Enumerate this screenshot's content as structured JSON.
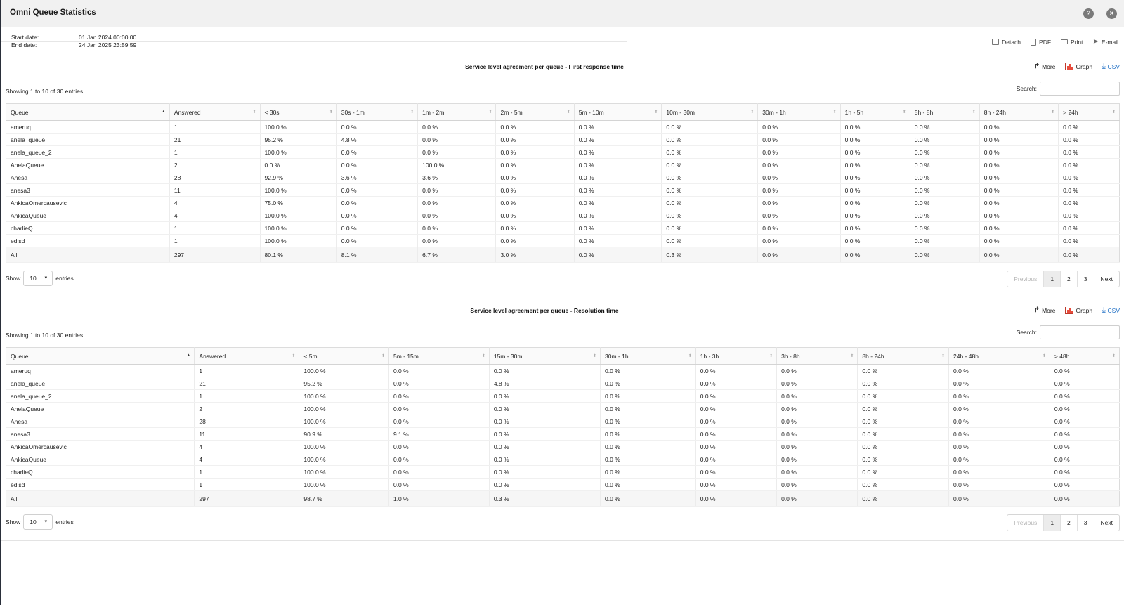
{
  "window": {
    "title": "Omni Queue Statistics",
    "help_icon": "question-circle-icon",
    "close_icon": "close-circle-icon"
  },
  "dates": {
    "start_label": "Start date:",
    "start_value": "01 Jan 2024 00:00:00",
    "end_label": "End date:",
    "end_value": "24 Jan 2025 23:59:59"
  },
  "toolbar": {
    "detach": "Detach",
    "pdf": "PDF",
    "print": "Print",
    "email": "E-mail"
  },
  "actions": {
    "more": "More",
    "graph": "Graph",
    "csv": "CSV"
  },
  "common": {
    "search_label": "Search:",
    "show_label": "Show",
    "entries_label": "entries",
    "page_length": "10",
    "pages": [
      "Previous",
      "1",
      "2",
      "3",
      "Next"
    ],
    "active_page": "1"
  },
  "tables": [
    {
      "title": "Service level agreement per queue - First response time",
      "showing": "Showing 1 to 10 of 30 entries",
      "columns": [
        "Queue",
        "Answered",
        "< 30s",
        "30s - 1m",
        "1m - 2m",
        "2m - 5m",
        "5m - 10m",
        "10m - 30m",
        "30m - 1h",
        "1h - 5h",
        "5h - 8h",
        "8h - 24h",
        "> 24h"
      ],
      "rows": [
        [
          "ameruq",
          "1",
          "100.0 %",
          "0.0 %",
          "0.0 %",
          "0.0 %",
          "0.0 %",
          "0.0 %",
          "0.0 %",
          "0.0 %",
          "0.0 %",
          "0.0 %",
          "0.0 %"
        ],
        [
          "anela_queue",
          "21",
          "95.2 %",
          "4.8 %",
          "0.0 %",
          "0.0 %",
          "0.0 %",
          "0.0 %",
          "0.0 %",
          "0.0 %",
          "0.0 %",
          "0.0 %",
          "0.0 %"
        ],
        [
          "anela_queue_2",
          "1",
          "100.0 %",
          "0.0 %",
          "0.0 %",
          "0.0 %",
          "0.0 %",
          "0.0 %",
          "0.0 %",
          "0.0 %",
          "0.0 %",
          "0.0 %",
          "0.0 %"
        ],
        [
          "AnelaQueue",
          "2",
          "0.0 %",
          "0.0 %",
          "100.0 %",
          "0.0 %",
          "0.0 %",
          "0.0 %",
          "0.0 %",
          "0.0 %",
          "0.0 %",
          "0.0 %",
          "0.0 %"
        ],
        [
          "Anesa",
          "28",
          "92.9 %",
          "3.6 %",
          "3.6 %",
          "0.0 %",
          "0.0 %",
          "0.0 %",
          "0.0 %",
          "0.0 %",
          "0.0 %",
          "0.0 %",
          "0.0 %"
        ],
        [
          "anesa3",
          "11",
          "100.0 %",
          "0.0 %",
          "0.0 %",
          "0.0 %",
          "0.0 %",
          "0.0 %",
          "0.0 %",
          "0.0 %",
          "0.0 %",
          "0.0 %",
          "0.0 %"
        ],
        [
          "AnkicaOmercausevic",
          "4",
          "75.0 %",
          "0.0 %",
          "0.0 %",
          "0.0 %",
          "0.0 %",
          "0.0 %",
          "0.0 %",
          "0.0 %",
          "0.0 %",
          "0.0 %",
          "0.0 %"
        ],
        [
          "AnkicaQueue",
          "4",
          "100.0 %",
          "0.0 %",
          "0.0 %",
          "0.0 %",
          "0.0 %",
          "0.0 %",
          "0.0 %",
          "0.0 %",
          "0.0 %",
          "0.0 %",
          "0.0 %"
        ],
        [
          "charlieQ",
          "1",
          "100.0 %",
          "0.0 %",
          "0.0 %",
          "0.0 %",
          "0.0 %",
          "0.0 %",
          "0.0 %",
          "0.0 %",
          "0.0 %",
          "0.0 %",
          "0.0 %"
        ],
        [
          "edisd",
          "1",
          "100.0 %",
          "0.0 %",
          "0.0 %",
          "0.0 %",
          "0.0 %",
          "0.0 %",
          "0.0 %",
          "0.0 %",
          "0.0 %",
          "0.0 %",
          "0.0 %"
        ]
      ],
      "total": [
        "All",
        "297",
        "80.1 %",
        "8.1 %",
        "6.7 %",
        "3.0 %",
        "0.0 %",
        "0.3 %",
        "0.0 %",
        "0.0 %",
        "0.0 %",
        "0.0 %",
        "0.0 %"
      ]
    },
    {
      "title": "Service level agreement per queue - Resolution time",
      "showing": "Showing 1 to 10 of 30 entries",
      "columns": [
        "Queue",
        "Answered",
        "< 5m",
        "5m - 15m",
        "15m - 30m",
        "30m - 1h",
        "1h - 3h",
        "3h - 8h",
        "8h - 24h",
        "24h - 48h",
        "> 48h"
      ],
      "rows": [
        [
          "ameruq",
          "1",
          "100.0 %",
          "0.0 %",
          "0.0 %",
          "0.0 %",
          "0.0 %",
          "0.0 %",
          "0.0 %",
          "0.0 %",
          "0.0 %"
        ],
        [
          "anela_queue",
          "21",
          "95.2 %",
          "0.0 %",
          "4.8 %",
          "0.0 %",
          "0.0 %",
          "0.0 %",
          "0.0 %",
          "0.0 %",
          "0.0 %"
        ],
        [
          "anela_queue_2",
          "1",
          "100.0 %",
          "0.0 %",
          "0.0 %",
          "0.0 %",
          "0.0 %",
          "0.0 %",
          "0.0 %",
          "0.0 %",
          "0.0 %"
        ],
        [
          "AnelaQueue",
          "2",
          "100.0 %",
          "0.0 %",
          "0.0 %",
          "0.0 %",
          "0.0 %",
          "0.0 %",
          "0.0 %",
          "0.0 %",
          "0.0 %"
        ],
        [
          "Anesa",
          "28",
          "100.0 %",
          "0.0 %",
          "0.0 %",
          "0.0 %",
          "0.0 %",
          "0.0 %",
          "0.0 %",
          "0.0 %",
          "0.0 %"
        ],
        [
          "anesa3",
          "11",
          "90.9 %",
          "9.1 %",
          "0.0 %",
          "0.0 %",
          "0.0 %",
          "0.0 %",
          "0.0 %",
          "0.0 %",
          "0.0 %"
        ],
        [
          "AnkicaOmercausevic",
          "4",
          "100.0 %",
          "0.0 %",
          "0.0 %",
          "0.0 %",
          "0.0 %",
          "0.0 %",
          "0.0 %",
          "0.0 %",
          "0.0 %"
        ],
        [
          "AnkicaQueue",
          "4",
          "100.0 %",
          "0.0 %",
          "0.0 %",
          "0.0 %",
          "0.0 %",
          "0.0 %",
          "0.0 %",
          "0.0 %",
          "0.0 %"
        ],
        [
          "charlieQ",
          "1",
          "100.0 %",
          "0.0 %",
          "0.0 %",
          "0.0 %",
          "0.0 %",
          "0.0 %",
          "0.0 %",
          "0.0 %",
          "0.0 %"
        ],
        [
          "edisd",
          "1",
          "100.0 %",
          "0.0 %",
          "0.0 %",
          "0.0 %",
          "0.0 %",
          "0.0 %",
          "0.0 %",
          "0.0 %",
          "0.0 %"
        ]
      ],
      "total": [
        "All",
        "297",
        "98.7 %",
        "1.0 %",
        "0.3 %",
        "0.0 %",
        "0.0 %",
        "0.0 %",
        "0.0 %",
        "0.0 %",
        "0.0 %"
      ]
    }
  ]
}
